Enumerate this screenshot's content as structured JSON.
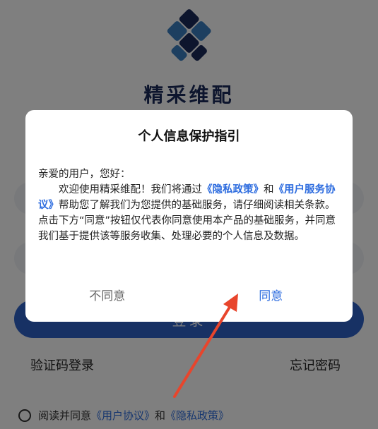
{
  "app": {
    "name": "精采维配"
  },
  "login": {
    "button_label": "登录"
  },
  "links": {
    "sms_login": "验证码登录",
    "forgot_password": "忘记密码"
  },
  "agreement": {
    "prefix": "阅读并同意",
    "user_agreement": "《用户协议》",
    "and": "和",
    "privacy_policy": "《隐私政策》"
  },
  "dialog": {
    "title": "个人信息保护指引",
    "greeting": "亲爱的用户，您好：",
    "text_1": "欢迎使用精采维配！我们将通过",
    "privacy_link": "《隐私政策》",
    "text_and": "和",
    "service_link": "《用户服务协议》",
    "text_2": "帮助您了解我们为您提供的基础服务，请仔细阅读相关条款。点击下方“同意”按钮仅代表你同意使用本产品的基础服务，并同意我们基于提供该等服务收集、处理必要的个人信息及数据。",
    "disagree_label": "不同意",
    "agree_label": "同意"
  },
  "colors": {
    "brand_navy": "#1a2a5a",
    "accent_blue": "#2d6cdf",
    "annotation_red": "#e8452c"
  },
  "icons": {
    "logo": "app-logo-icon",
    "radio": "radio-unchecked-icon",
    "arrow": "red-arrow-annotation"
  }
}
